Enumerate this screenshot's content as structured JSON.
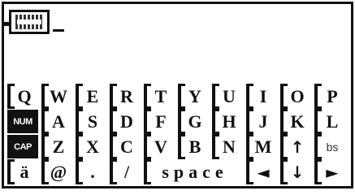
{
  "input": {
    "mode_icon": "keyboard-mode-icon",
    "text": ""
  },
  "keyboard": {
    "rows": [
      [
        "Q",
        "W",
        "E",
        "R",
        "T",
        "Y",
        "U",
        "I",
        "O",
        "P"
      ],
      [
        "NUM",
        "A",
        "S",
        "D",
        "F",
        "G",
        "H",
        "J",
        "K",
        "L"
      ],
      [
        "CAP",
        "Z",
        "X",
        "C",
        "V",
        "B",
        "N",
        "M",
        "↑",
        "bs"
      ],
      [
        "ä",
        "@",
        ".",
        "/",
        "space",
        "◄",
        "↓",
        "►"
      ]
    ]
  },
  "colors": {
    "foreground": "#111111",
    "background": "#ffffff"
  }
}
